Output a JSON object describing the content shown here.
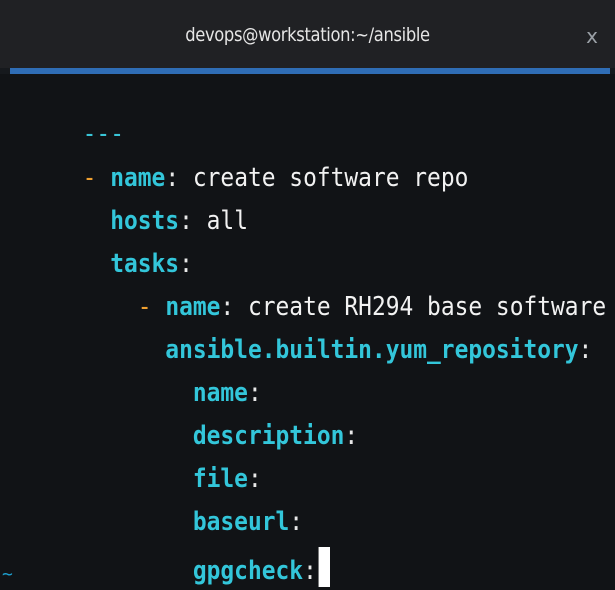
{
  "window": {
    "title": "devops@workstation:~/ansible",
    "close_label": "x"
  },
  "editor": {
    "doc_start": "---",
    "play": {
      "dash": "-",
      "name_key": "name",
      "name_value": "create software repo",
      "hosts_key": "hosts",
      "hosts_value": "all",
      "tasks_key": "tasks"
    },
    "task": {
      "dash": "-",
      "name_key": "name",
      "name_value": "create RH294 base software",
      "module_key": "ansible.builtin.yum_repository",
      "params": [
        "name",
        "description",
        "file",
        "baseurl",
        "gpgcheck"
      ]
    },
    "empty_line_marker": "~"
  },
  "colors": {
    "key": "#33c6da",
    "dash": "#f0a030",
    "tabline": "#2f6db5",
    "background": "#111316"
  }
}
